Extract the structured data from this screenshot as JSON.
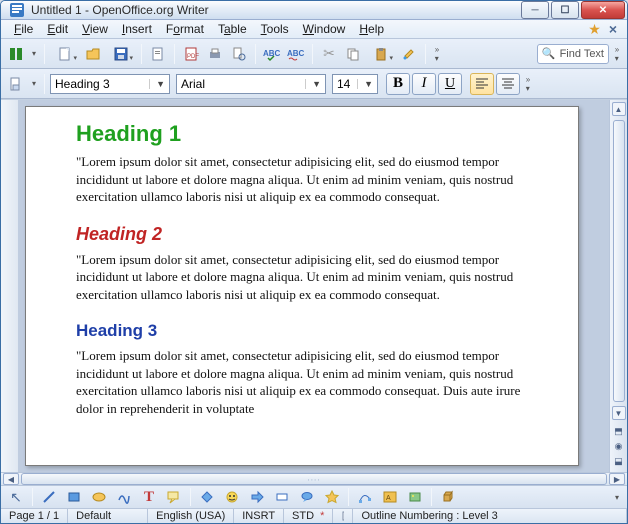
{
  "window": {
    "title": "Untitled 1 - OpenOffice.org Writer"
  },
  "menubar": {
    "file": "File",
    "edit": "Edit",
    "view": "View",
    "insert": "Insert",
    "format": "Format",
    "table": "Table",
    "tools": "Tools",
    "window": "Window",
    "help": "Help"
  },
  "find": {
    "placeholder": "Find Text"
  },
  "format_bar": {
    "style": "Heading 3",
    "font": "Arial",
    "size": "14",
    "bold": "B",
    "italic": "I",
    "underline": "U"
  },
  "document": {
    "h1": "Heading 1",
    "p1": "\"Lorem ipsum dolor sit amet, consectetur adipisicing elit, sed do eiusmod tempor incididunt ut labore et dolore magna aliqua. Ut enim ad minim veniam, quis nostrud exercitation ullamco laboris nisi ut aliquip ex ea commodo consequat.",
    "h2": "Heading 2",
    "p2": "\"Lorem ipsum dolor sit amet, consectetur adipisicing elit, sed do eiusmod tempor incididunt ut labore et dolore magna aliqua. Ut enim ad minim veniam, quis nostrud exercitation ullamco laboris nisi ut aliquip ex ea commodo consequat.",
    "h3": "Heading 3",
    "p3": "\"Lorem ipsum dolor sit amet, consectetur adipisicing elit, sed do eiusmod tempor incididunt ut labore et dolore magna aliqua. Ut enim ad minim veniam, quis nostrud exercitation ullamco laboris nisi ut aliquip ex ea commodo consequat. Duis aute irure dolor in reprehenderit in voluptate"
  },
  "status": {
    "page": "Page 1 / 1",
    "style": "Default",
    "lang": "English (USA)",
    "insert_mode": "INSRT",
    "sel_mode": "STD",
    "outline": "Outline Numbering : Level 3"
  }
}
